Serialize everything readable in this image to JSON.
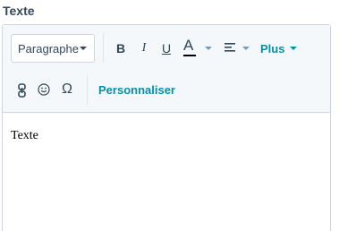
{
  "field": {
    "label": "Texte"
  },
  "toolbar": {
    "paragraph_select": "Paragraphe",
    "bold": "B",
    "italic": "I",
    "underline": "U",
    "text_color": "A",
    "more": "Plus",
    "special_char": "Ω",
    "personalize": "Personnaliser"
  },
  "editor": {
    "content": "Texte"
  },
  "colors": {
    "accent": "#0091ae",
    "text": "#33475b",
    "toolbar_bg": "#f5f8fa",
    "border": "#cbd6e2"
  }
}
